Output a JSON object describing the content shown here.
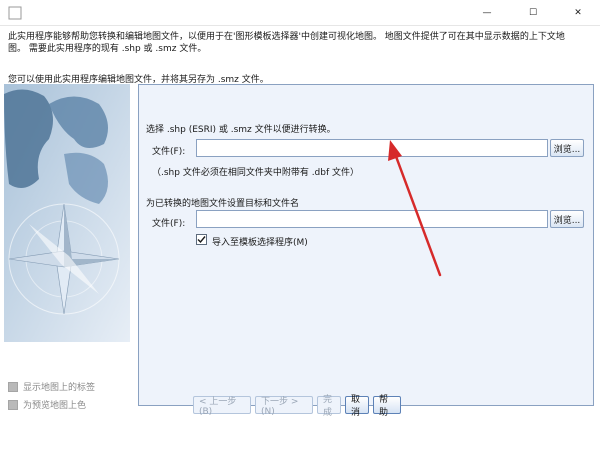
{
  "window": {
    "minimize_glyph": "—",
    "maximize_glyph": "☐",
    "close_glyph": "✕"
  },
  "intro": {
    "line1": "此实用程序能够帮助您转换和编辑地图文件，以便用于在'图形模板选择器'中创建可视化地图。 地图文件提供了可在其中显示数据的上下文地",
    "line2": "图。 需要此实用程序的现有 .shp 或 .smz 文件。",
    "line3": "您可以使用此实用程序编辑地图文件，并将其另存为 .smz 文件。"
  },
  "left_options": {
    "show_labels": "显示地图上的标签",
    "color_preview": "为预览地图上色"
  },
  "source": {
    "heading": "选择 .shp (ESRI) 或 .smz 文件以便进行转换。",
    "file_label": "文件(F):",
    "file_value": "",
    "browse": "浏览...",
    "note": "（.shp 文件必须在相同文件夹中附带有 .dbf 文件）"
  },
  "target": {
    "heading": "为已转换的地图文件设置目标和文件名",
    "file_label": "文件(F):",
    "file_value": "",
    "browse": "浏览...",
    "import_label": "导入至模板选择程序(M)",
    "import_checked": true
  },
  "footer": {
    "back": "< 上一步(B)",
    "next": "下一步 >(N)",
    "finish": "完成",
    "cancel": "取消",
    "help": "帮助"
  },
  "colors": {
    "accent": "#d62a2a",
    "panel_bg": "#eef3fb",
    "panel_border": "#8aa1c1"
  }
}
